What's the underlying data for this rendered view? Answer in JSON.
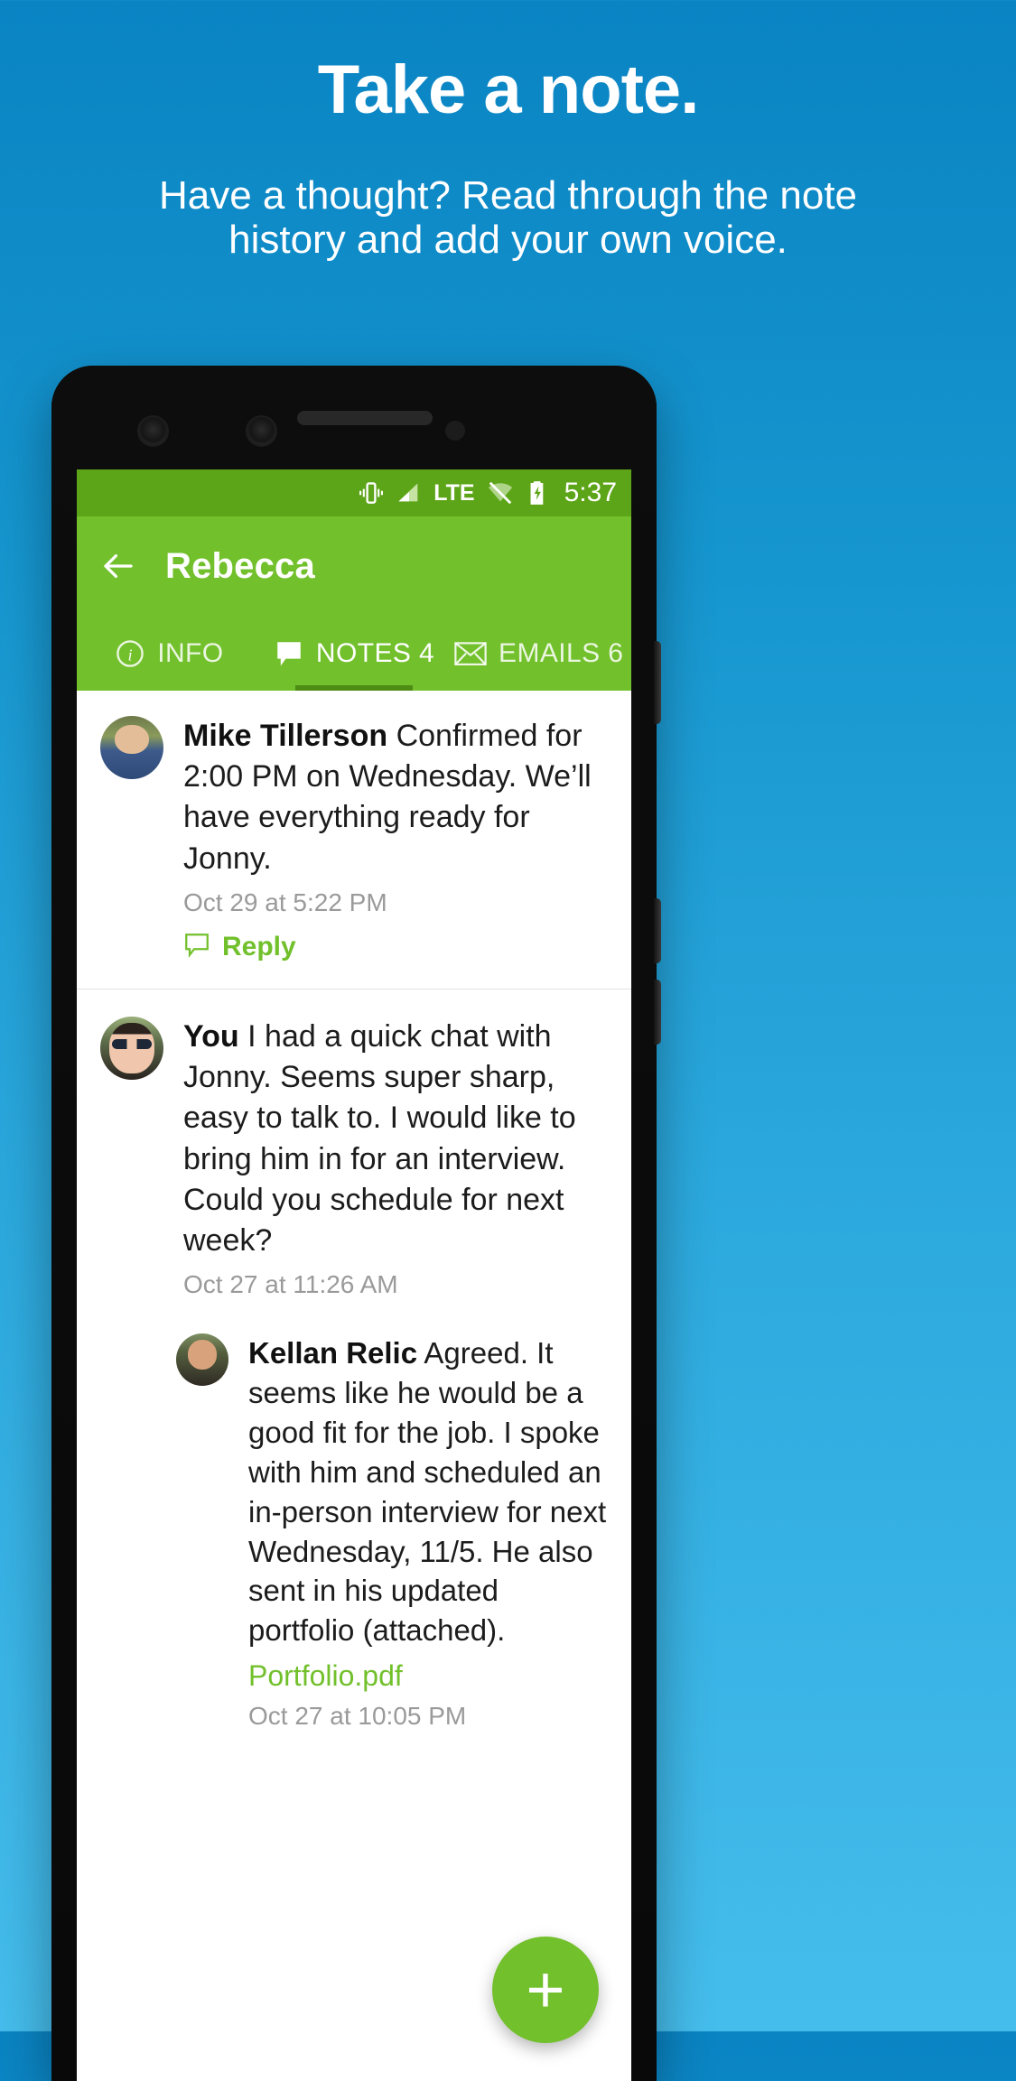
{
  "promo": {
    "title": "Take a note.",
    "subtitle": "Have a thought? Read through the note history and add your own voice."
  },
  "colors": {
    "background_top": "#0a84c3",
    "background_bottom": "#45bdec",
    "brand_green": "#72c02c",
    "statusbar_green": "#5da518",
    "tab_indicator": "#4e8c14",
    "link_green": "#72c02c",
    "timestamp_gray": "#9a9a9a"
  },
  "statusbar": {
    "icons": [
      "vibrate-icon",
      "signal-icon",
      "lte-icon",
      "wifi-off-icon",
      "battery-charging-icon"
    ],
    "lte_label": "LTE",
    "time": "5:37"
  },
  "appbar": {
    "back_icon": "back-arrow-icon",
    "title": "Rebecca"
  },
  "tabs": [
    {
      "id": "info",
      "icon": "info-icon",
      "label": "INFO",
      "active": false
    },
    {
      "id": "notes",
      "icon": "speech-bubble-icon",
      "label": "NOTES 4",
      "active": true
    },
    {
      "id": "emails",
      "icon": "envelope-icon",
      "label": "EMAILS 6",
      "active": false
    }
  ],
  "notes": [
    {
      "avatar": "a-mike",
      "author": "Mike Tillerson",
      "text": " Confirmed for 2:00 PM on Wednesday. We’ll have everything ready for Jonny.",
      "time": "Oct 29 at 5:22 PM",
      "reply_label": "Reply",
      "reply_icon": "reply-bubble-icon"
    },
    {
      "avatar": "a-you",
      "author": "You",
      "text": " I had a quick chat with Jonny. Seems super sharp, easy to talk to. I would like to bring him in for an interview. Could you schedule for next week?",
      "time": "Oct 27 at 11:26 AM"
    }
  ],
  "nested_reply": {
    "avatar": "a-kellan",
    "author": "Kellan Relic",
    "text": " Agreed. It seems like he would be a good fit for the job. I spoke with him and scheduled an in-person interview for next Wednesday, 11/5. He also sent in his updated portfolio (attached).",
    "attachment": "Portfolio.pdf",
    "time": "Oct 27 at 10:05 PM"
  },
  "fab": {
    "icon": "plus-icon",
    "label": "+"
  }
}
